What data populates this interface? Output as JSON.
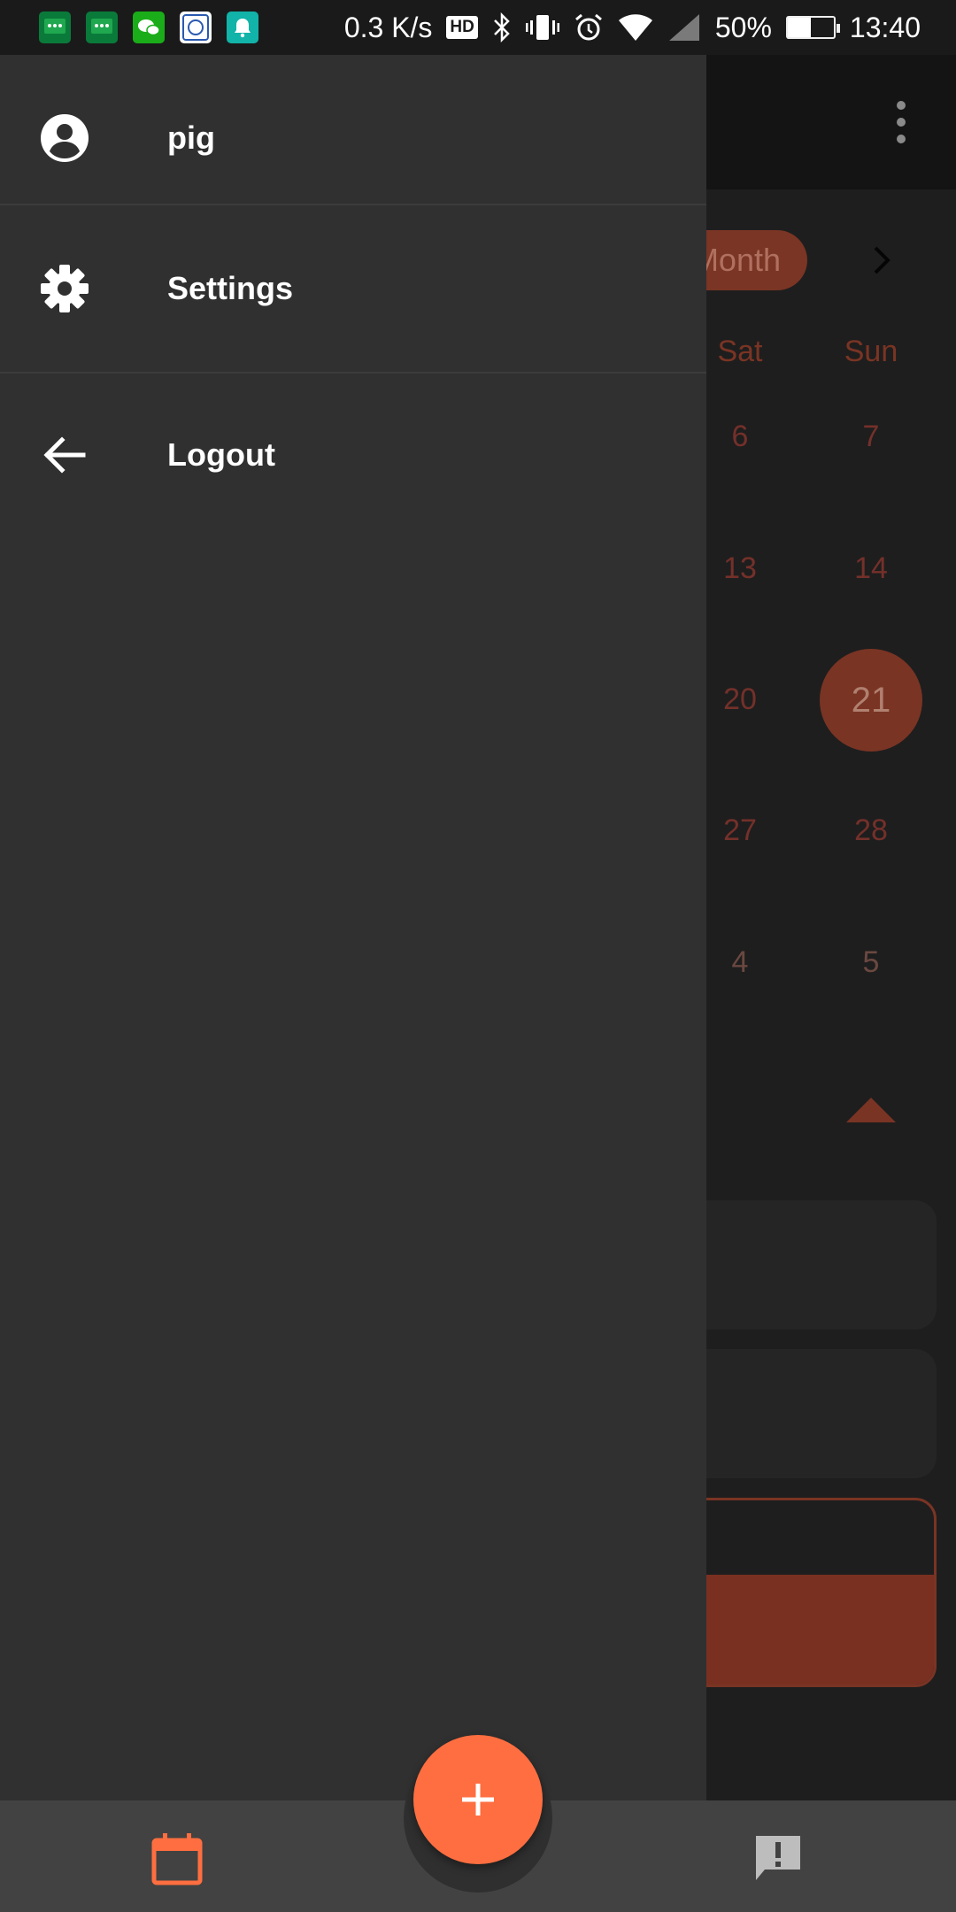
{
  "status_bar": {
    "net_speed": "0.3 K/s",
    "hd_badge": "HD",
    "battery": "50%",
    "battery_level": 0.5,
    "time": "13:40",
    "notification_icons": [
      "message-icon",
      "message-icon",
      "wechat-icon",
      "app-icon",
      "bell-icon"
    ]
  },
  "drawer": {
    "items": [
      {
        "label": "pig",
        "icon": "account-circle-icon"
      },
      {
        "label": "Settings",
        "icon": "gear-icon"
      },
      {
        "label": "Logout",
        "icon": "arrow-left-icon"
      }
    ]
  },
  "calendar": {
    "month_pill": "Month",
    "weekdays": [
      "Sat",
      "Sun"
    ],
    "rows": [
      [
        "6",
        "7"
      ],
      [
        "13",
        "14"
      ],
      [
        "20",
        "21"
      ],
      [
        "27",
        "28"
      ],
      [
        "4",
        "5"
      ]
    ],
    "today": "21"
  },
  "fab": {
    "icon": "plus-icon"
  },
  "bottom_nav": {
    "left_icon": "calendar-icon",
    "right_icon": "feedback-icon"
  },
  "colors": {
    "accent": "#ff6e40",
    "drawer_bg": "#303030",
    "bottom_bar": "#424242",
    "dim_accent": "#7a3424"
  }
}
